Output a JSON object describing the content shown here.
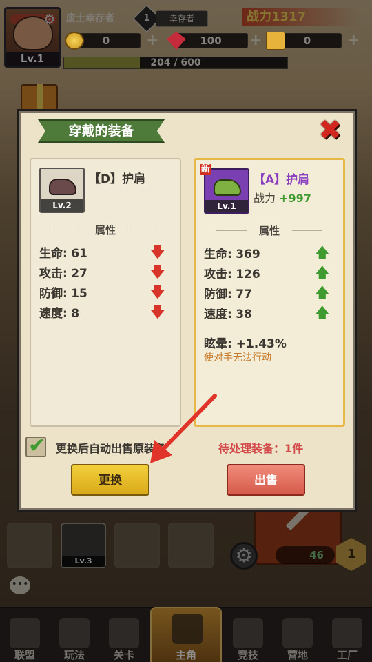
{
  "player": {
    "name": "废土幸存者",
    "level": "Lv.1",
    "rank_level": "1",
    "rank_title": "幸存者",
    "power_label": "战力",
    "power_value": "1317",
    "xp_text": "204 / 600",
    "xp_progress": 0.34
  },
  "resources": [
    {
      "icon": "coin-icon",
      "value": "0"
    },
    {
      "icon": "gem-icon",
      "value": "100"
    },
    {
      "icon": "ticket-icon",
      "value": "0"
    }
  ],
  "dialog": {
    "title": "穿戴的装备",
    "current": {
      "name": "【D】护肩",
      "level": "Lv.2",
      "section_label": "属性",
      "stats": [
        {
          "label": "生命:",
          "value": "61",
          "trend": "down"
        },
        {
          "label": "攻击:",
          "value": "27",
          "trend": "down"
        },
        {
          "label": "防御:",
          "value": "15",
          "trend": "down"
        },
        {
          "label": "速度:",
          "value": "8",
          "trend": "down"
        }
      ]
    },
    "candidate": {
      "new_tag": "新",
      "name": "【A】护肩",
      "level": "Lv.1",
      "power_label": "战力",
      "power_delta": "+997",
      "section_label": "属性",
      "stats": [
        {
          "label": "生命:",
          "value": "369",
          "trend": "up"
        },
        {
          "label": "攻击:",
          "value": "126",
          "trend": "up"
        },
        {
          "label": "防御:",
          "value": "77",
          "trend": "up"
        },
        {
          "label": "速度:",
          "value": "38",
          "trend": "up"
        }
      ],
      "extra_label": "眩晕:",
      "extra_value": "+1.43%",
      "extra_desc": "使对手无法行动"
    },
    "auto_sell_label": "更换后自动出售原装备",
    "auto_sell_checked": true,
    "pending_text": "待处理装备：1件",
    "swap_label": "更换",
    "sell_label": "出售"
  },
  "background": {
    "slot_level": "Lv.3",
    "resource_count": "46",
    "hex_badge": "1"
  },
  "nav": [
    {
      "label": "联盟",
      "active": false
    },
    {
      "label": "玩法",
      "active": false
    },
    {
      "label": "关卡",
      "active": false
    },
    {
      "label": "主角",
      "active": true
    },
    {
      "label": "竞技",
      "active": false
    },
    {
      "label": "营地",
      "active": false
    },
    {
      "label": "工厂",
      "active": false
    }
  ],
  "colors": {
    "accent_green": "#3f9a2f",
    "accent_red": "#d9342a",
    "swap_button": "#f3cf3c",
    "sell_button": "#e07060",
    "rare_purple": "#8a3ec0"
  }
}
